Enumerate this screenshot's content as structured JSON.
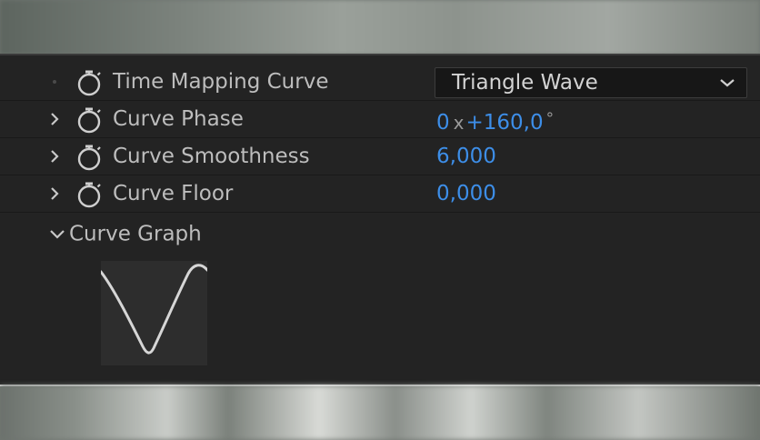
{
  "properties": {
    "time_mapping_curve": {
      "label": "Time Mapping Curve",
      "value": "Triangle Wave"
    },
    "curve_phase": {
      "label": "Curve Phase",
      "revolutions": "0",
      "separator": "x",
      "degrees": "+160,0",
      "degree_symbol": "°"
    },
    "curve_smoothness": {
      "label": "Curve Smoothness",
      "value": "6,000"
    },
    "curve_floor": {
      "label": "Curve Floor",
      "value": "0,000"
    }
  },
  "curve_graph": {
    "label": "Curve Graph",
    "expanded": true,
    "shape": "triangle-wave"
  },
  "icons": {
    "stopwatch": "stopwatch-icon",
    "twirl_collapsed": "chevron-right-icon",
    "twirl_expanded": "chevron-down-icon",
    "dropdown": "chevron-down-icon"
  },
  "colors": {
    "panel_bg": "#232323",
    "label": "#bdbdbd",
    "value": "#3d8ee8",
    "graph_bg": "#2d2d2d",
    "graph_line": "#d6d6d6"
  }
}
